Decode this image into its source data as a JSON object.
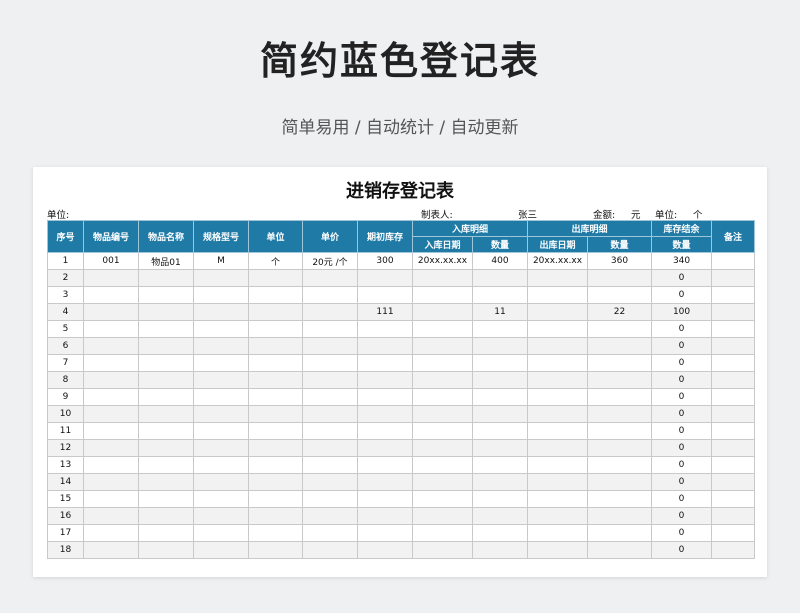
{
  "banner": {
    "title": "简约蓝色登记表",
    "subtitle": "简单易用 / 自动统计 / 自动更新"
  },
  "sheet": {
    "title": "进销存登记表",
    "meta": {
      "unit_label": "单位:",
      "maker_label": "制表人:",
      "maker_value": "张三",
      "amount_label": "金额:",
      "amount_unit": "元",
      "unit2_label": "单位:",
      "unit2_value": "个"
    },
    "headers": {
      "seq": "序号",
      "code": "物品编号",
      "name": "物品名称",
      "spec": "规格型号",
      "unit": "单位",
      "price": "单价",
      "opening": "期初库存",
      "in_group": "入库明细",
      "out_group": "出库明细",
      "balance_group": "库存结余",
      "remark": "备注",
      "in_date": "入库日期",
      "in_qty": "数量",
      "out_date": "出库日期",
      "out_qty": "数量",
      "balance_qty": "数量"
    },
    "rows": [
      [
        "1",
        "001",
        "物品01",
        "M",
        "个",
        "20元 /个",
        "300",
        "20xx.xx.xx",
        "400",
        "20xx.xx.xx",
        "360",
        "340",
        ""
      ],
      [
        "2",
        "",
        "",
        "",
        "",
        "",
        "",
        "",
        "",
        "",
        "",
        "0",
        ""
      ],
      [
        "3",
        "",
        "",
        "",
        "",
        "",
        "",
        "",
        "",
        "",
        "",
        "0",
        ""
      ],
      [
        "4",
        "",
        "",
        "",
        "",
        "",
        "111",
        "",
        "11",
        "",
        "22",
        "100",
        ""
      ],
      [
        "5",
        "",
        "",
        "",
        "",
        "",
        "",
        "",
        "",
        "",
        "",
        "0",
        ""
      ],
      [
        "6",
        "",
        "",
        "",
        "",
        "",
        "",
        "",
        "",
        "",
        "",
        "0",
        ""
      ],
      [
        "7",
        "",
        "",
        "",
        "",
        "",
        "",
        "",
        "",
        "",
        "",
        "0",
        ""
      ],
      [
        "8",
        "",
        "",
        "",
        "",
        "",
        "",
        "",
        "",
        "",
        "",
        "0",
        ""
      ],
      [
        "9",
        "",
        "",
        "",
        "",
        "",
        "",
        "",
        "",
        "",
        "",
        "0",
        ""
      ],
      [
        "10",
        "",
        "",
        "",
        "",
        "",
        "",
        "",
        "",
        "",
        "",
        "0",
        ""
      ],
      [
        "11",
        "",
        "",
        "",
        "",
        "",
        "",
        "",
        "",
        "",
        "",
        "0",
        ""
      ],
      [
        "12",
        "",
        "",
        "",
        "",
        "",
        "",
        "",
        "",
        "",
        "",
        "0",
        ""
      ],
      [
        "13",
        "",
        "",
        "",
        "",
        "",
        "",
        "",
        "",
        "",
        "",
        "0",
        ""
      ],
      [
        "14",
        "",
        "",
        "",
        "",
        "",
        "",
        "",
        "",
        "",
        "",
        "0",
        ""
      ],
      [
        "15",
        "",
        "",
        "",
        "",
        "",
        "",
        "",
        "",
        "",
        "",
        "0",
        ""
      ],
      [
        "16",
        "",
        "",
        "",
        "",
        "",
        "",
        "",
        "",
        "",
        "",
        "0",
        ""
      ],
      [
        "17",
        "",
        "",
        "",
        "",
        "",
        "",
        "",
        "",
        "",
        "",
        "0",
        ""
      ],
      [
        "18",
        "",
        "",
        "",
        "",
        "",
        "",
        "",
        "",
        "",
        "",
        "0",
        ""
      ]
    ]
  },
  "colors": {
    "header_bg": "#1f7aa6",
    "stripe_bg": "#f2f2f2"
  }
}
